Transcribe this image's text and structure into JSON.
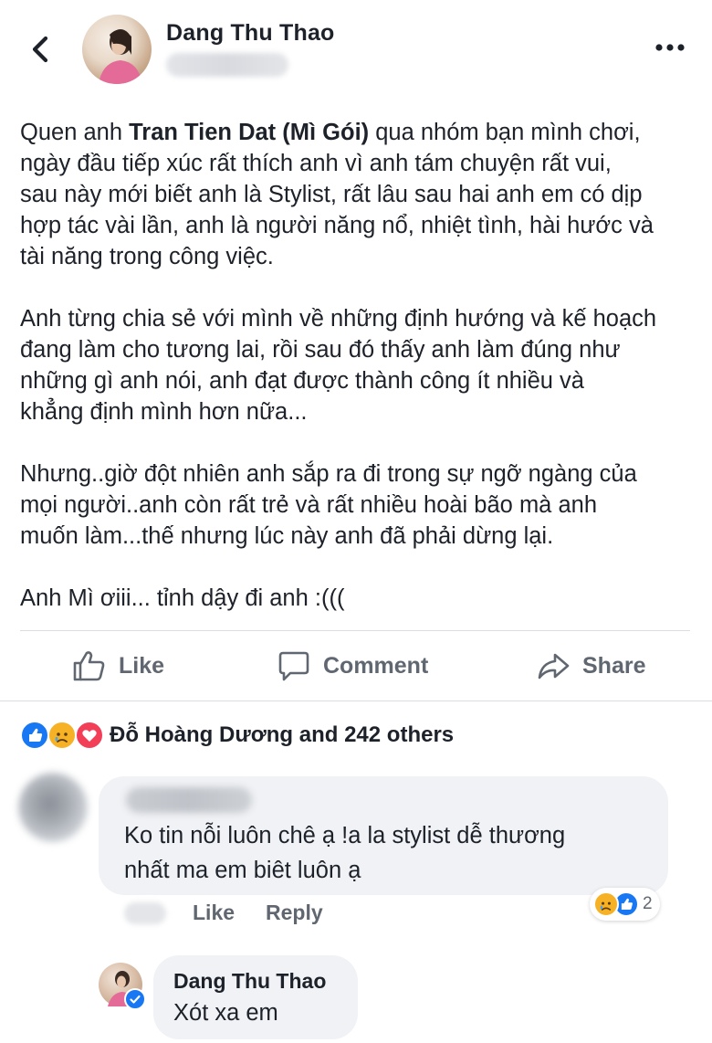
{
  "header": {
    "author_name": "Dang Thu Thao",
    "back_icon": "chevron-left-icon",
    "more_icon": "more-horizontal-icon"
  },
  "post": {
    "p1_prefix": "Quen anh ",
    "p1_bold": "Tran Tien Dat (Mì Gói)",
    "p1_suffix": " qua nhóm bạn mình chơi,",
    "p1_lines": [
      "ngày đầu tiếp xúc rất thích anh vì anh tám chuyện rất vui,",
      "sau này mới biết anh là Stylist, rất lâu sau hai anh em có dịp",
      "hợp tác vài lần, anh là người năng nổ, nhiệt tình, hài hước và",
      "tài năng trong công việc."
    ],
    "p2_lines": [
      "Anh từng chia sẻ với mình về những định hướng và kế hoạch",
      "đang làm cho tương lai, rồi sau đó thấy anh làm đúng như",
      "những gì anh nói, anh đạt được thành công ít nhiều và",
      "khẳng định mình hơn nữa..."
    ],
    "p3_lines": [
      "Nhưng..giờ đột nhiên anh sắp ra đi trong sự ngỡ ngàng của",
      "mọi người..anh còn rất trẻ và rất nhiều hoài bão mà anh",
      "muốn làm...thế nhưng lúc này anh đã phải dừng lại."
    ],
    "p4_lines": [
      "Anh Mì ơiii... tỉnh dậy đi anh :((("
    ]
  },
  "actions": {
    "like": "Like",
    "comment": "Comment",
    "share": "Share"
  },
  "reactions": {
    "summary": "Đỗ Hoàng Dương and 242 others",
    "icons": [
      "like-icon",
      "sad-icon",
      "love-icon"
    ]
  },
  "comments": [
    {
      "text_lines": [
        "Ko tin nỗi luôn chê ạ !a la stylist dễ thương",
        "nhất ma em biêt luôn ạ"
      ],
      "like_label": "Like",
      "reply_label": "Reply",
      "reaction_count": "2"
    },
    {
      "author": "Dang Thu Thao",
      "text": "Xót xa em"
    }
  ],
  "colors": {
    "like_blue": "#1877f2",
    "love_red": "#f33e58",
    "sad_yellow": "#f7b125",
    "muted_text": "#606770",
    "bubble_bg": "#f0f2f5"
  }
}
